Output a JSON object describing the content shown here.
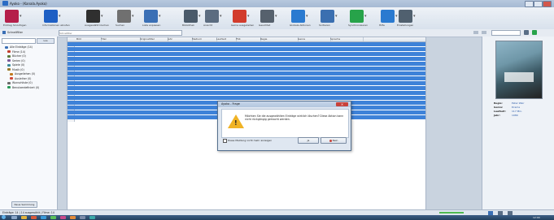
{
  "window": {
    "title": "Ayoko - (Kanala.Ayoko)",
    "colors": {
      "selection": "#3e82d8",
      "titlebar": "#b7c8de",
      "taskbar": "#2b4a70",
      "warning": "#f0b325"
    }
  },
  "toolbar": {
    "buttons": [
      {
        "label": "Eintrag hinzufügen",
        "icon": "add-entry-icon",
        "color": "#b51e4a"
      },
      {
        "label": "Informationen abrufen",
        "icon": "info-icon",
        "color": "#1e5fc4"
      },
      {
        "label": "Ausgewählt löschen",
        "icon": "delete-icon",
        "color": "#2f2f2f"
      },
      {
        "label": "Suchen",
        "icon": "search-icon",
        "color": "#707070"
      },
      {
        "label": "Liste anpassen",
        "icon": "list-icon",
        "color": "#3a6fb5"
      },
      {
        "label": "Bibliothek",
        "icon": "library-icon",
        "color": "#4a5a6a"
      },
      {
        "label": "Ansicht",
        "icon": "view-icon",
        "color": "#5b6c80"
      },
      {
        "label": "Gerne ausgeliehen",
        "icon": "lend-icon",
        "color": "#d23c2c"
      },
      {
        "label": "Gesichtet",
        "icon": "watched-icon",
        "color": "#56616d"
      },
      {
        "label": "Globale Aktionen",
        "icon": "globe-icon",
        "color": "#2a7ad0"
      },
      {
        "label": "Sortieren",
        "icon": "sort-icon",
        "color": "#3b6fb0"
      },
      {
        "label": "Synchronisieren",
        "icon": "sync-icon",
        "color": "#27a34a"
      },
      {
        "label": "Hilfe",
        "icon": "help-icon",
        "color": "#2a7ad0"
      },
      {
        "label": "Einstellungen",
        "icon": "settings-icon",
        "color": "#50606f"
      }
    ]
  },
  "filterbar": {
    "label": "Schnellfilter",
    "placeholder": "Schnellfilter"
  },
  "sidebar": {
    "search_button": "Los",
    "items": [
      {
        "label": "Alle Einträge (14)",
        "color": "#3a6fb5",
        "indent": 0
      },
      {
        "label": "Filme (14)",
        "color": "#c23d2c",
        "indent": 1
      },
      {
        "label": "Bücher (0)",
        "color": "#5a7a3a",
        "indent": 1
      },
      {
        "label": "Serien (0)",
        "color": "#7a5a9a",
        "indent": 1
      },
      {
        "label": "Spiele (0)",
        "color": "#3a8a9a",
        "indent": 1
      },
      {
        "label": "Musik (0)",
        "color": "#9a7a2a",
        "indent": 1
      },
      {
        "label": "Ausgeliehen (0)",
        "color": "#c07a20",
        "indent": 2
      },
      {
        "label": "Ausleiher (0)",
        "color": "#d04a3a",
        "indent": 2
      },
      {
        "label": "Wunschliste (0)",
        "color": "#6a6a6a",
        "indent": 1
      },
      {
        "label": "Benutzerdefiniert (0)",
        "color": "#2a9a5a",
        "indent": 1
      }
    ],
    "new_collection": "Neue Sammlung"
  },
  "grid": {
    "columns": [
      "Bild",
      "Titel",
      "Originaltitel",
      "Jahr",
      "Medium",
      "Laufzeit",
      "FSK",
      "Regie",
      "Genre",
      "Sprache"
    ],
    "row_count": 16
  },
  "dialog": {
    "title": "Ayoko - Frage",
    "message": "Möchten Sie die ausgewählten Einträge wirklich löschen? Diese Aktion kann nicht rückgängig gemacht werden.",
    "checkbox_label": "Diese Meldung nicht mehr anzeigen",
    "yes_label": "Ja",
    "no_label": "Nein"
  },
  "details": {
    "fields": [
      {
        "k": "Regie:",
        "v": "Peter Weir"
      },
      {
        "k": "Genre:",
        "v": "Drama"
      },
      {
        "k": "Laufzeit:",
        "v": "117 Min."
      },
      {
        "k": "Jahr:",
        "v": "1989"
      }
    ]
  },
  "status": {
    "text": "Einträge: 14 | 14 ausgewählt | Filme: 14"
  },
  "taskbar": {
    "clock": "12:00"
  }
}
